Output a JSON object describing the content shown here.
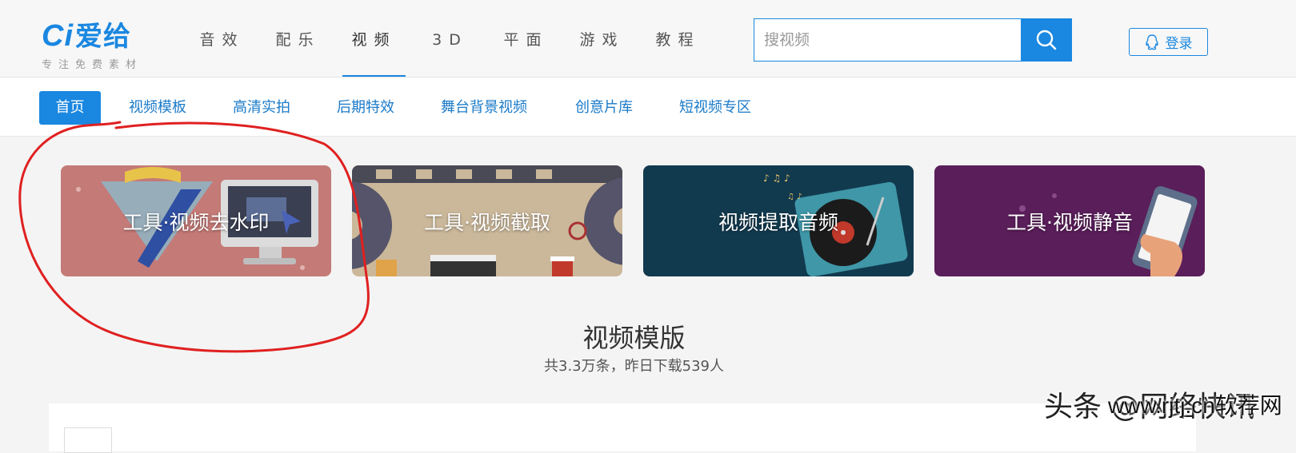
{
  "brand": {
    "logo_mark": "Ci",
    "logo_name": "爱给",
    "slogan": "专注免费素材"
  },
  "topnav": [
    {
      "label": "音效",
      "active": false
    },
    {
      "label": "配乐",
      "active": false
    },
    {
      "label": "视频",
      "active": true
    },
    {
      "label": "3D",
      "active": false
    },
    {
      "label": "平面",
      "active": false
    },
    {
      "label": "游戏",
      "active": false
    },
    {
      "label": "教程",
      "active": false
    }
  ],
  "search": {
    "placeholder": "搜视频",
    "value": "",
    "icon": "search-icon"
  },
  "login": {
    "label": "登录",
    "icon": "qq-penguin-icon"
  },
  "subnav": [
    {
      "label": "首页",
      "active": true
    },
    {
      "label": "视频模板",
      "active": false
    },
    {
      "label": "高清实拍",
      "active": false
    },
    {
      "label": "后期特效",
      "active": false
    },
    {
      "label": "舞台背景视频",
      "active": false
    },
    {
      "label": "创意片库",
      "active": false
    },
    {
      "label": "短视频专区",
      "active": false
    }
  ],
  "tools": [
    {
      "label": "工具·视频去水印"
    },
    {
      "label": "工具·视频截取"
    },
    {
      "label": "视频提取音频"
    },
    {
      "label": "工具·视频静音"
    }
  ],
  "section": {
    "title": "视频模版",
    "subtitle": "共3.3万条，昨日下载539人"
  },
  "watermark": {
    "text": "头条 @网络快讯",
    "url": "www.rjtj.cn软荐网"
  },
  "colors": {
    "accent": "#1a87e0",
    "annotation": "#e02020"
  }
}
